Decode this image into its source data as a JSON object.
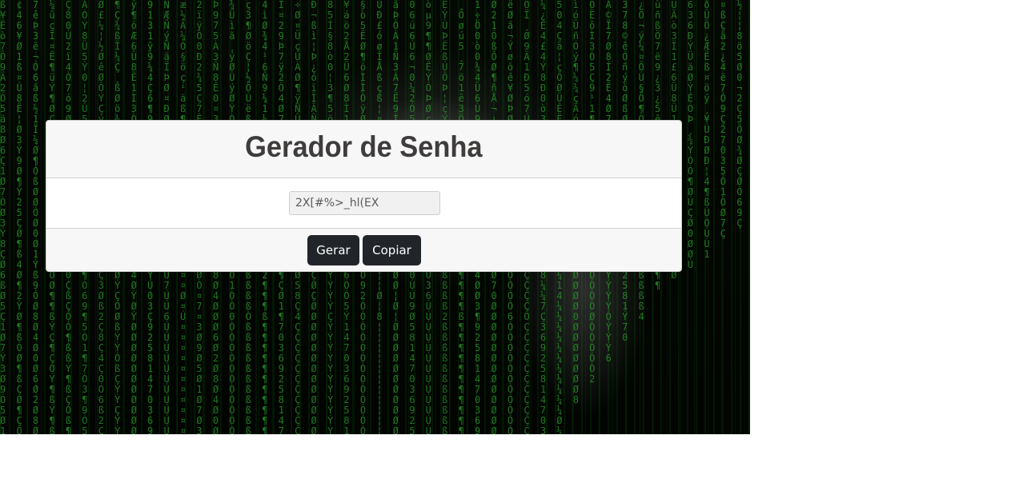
{
  "header": {
    "title": "Gerador de Senha"
  },
  "password": {
    "value": "2X[#%>_hl(EX"
  },
  "actions": {
    "generate_label": "Gerar",
    "copy_label": "Copiar"
  },
  "theme": {
    "button_bg": "#212529",
    "card_bg": "#f7f7f7",
    "title_color": "#3f3c3c",
    "rain_color": "#2e9a2e"
  }
}
